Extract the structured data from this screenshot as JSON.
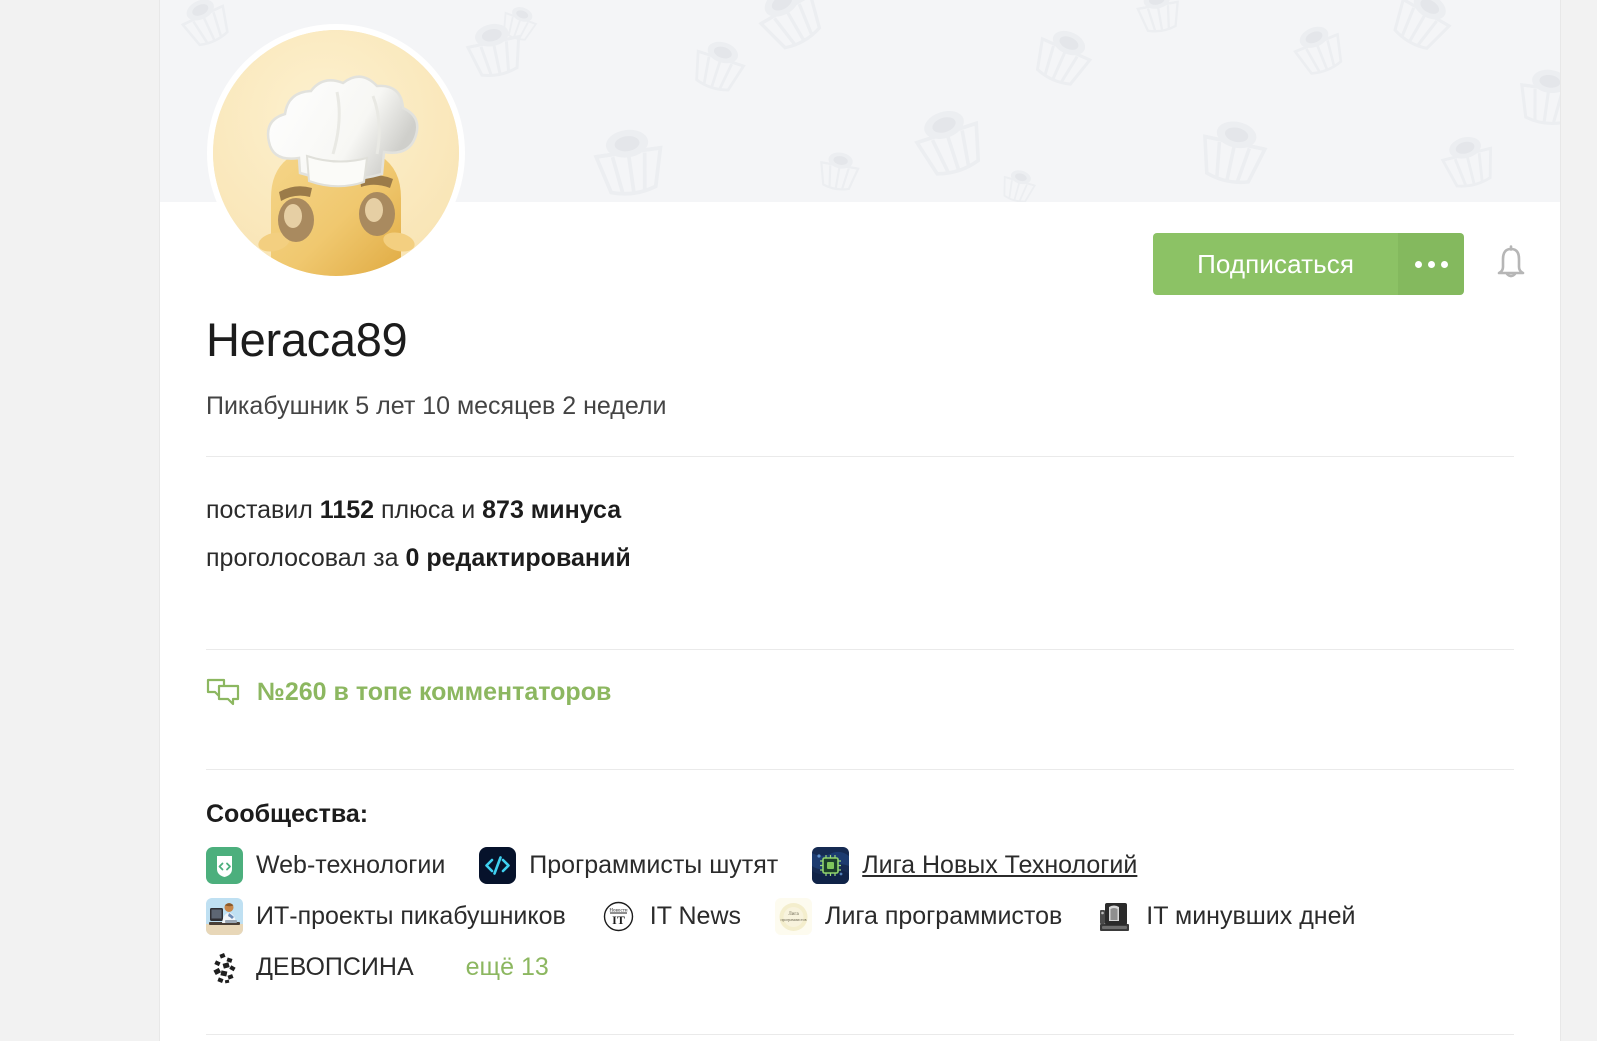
{
  "profile": {
    "username": "Heraca89",
    "subtitle": "Пикабушник 5 лет 10 месяцев 2 недели",
    "avatar_icon": "chef-hat-character-avatar",
    "banner_icon": "cupcake-pattern"
  },
  "actions": {
    "subscribe_label": "Подписаться",
    "more_icon": "ellipsis-icon",
    "bell_icon": "bell-icon",
    "accent_color": "#8cc265",
    "accent_dark_color": "#84b95e"
  },
  "stats": {
    "line1_pre": "поставил ",
    "plus_count": "1152",
    "line1_mid": " плюса и ",
    "minus_count": "873",
    "line1_post": " минуса",
    "line2_pre": "проголосовал за ",
    "edits_count": "0",
    "line2_post": " редактирований"
  },
  "rank": {
    "icon": "comments-icon",
    "text": "№260 в топе комментаторов",
    "color": "#8cb760"
  },
  "communities": {
    "title": "Сообщества:",
    "more_label": "ещё 13",
    "rows": [
      [
        {
          "name": "Web-технологии",
          "icon": "web-shield-code-icon",
          "hovered": false
        },
        {
          "name": "Программисты шутят",
          "icon": "code-tags-dark-icon",
          "hovered": false
        },
        {
          "name": "Лига Новых Технологий",
          "icon": "microchip-circuit-icon",
          "hovered": true
        }
      ],
      [
        {
          "name": "ИТ-проекты пикабушников",
          "icon": "person-at-computer-icon",
          "hovered": false
        },
        {
          "name": "IT News",
          "icon": "it-news-circle-icon",
          "hovered": false
        },
        {
          "name": "Лига программистов",
          "icon": "programmers-league-icon",
          "hovered": false
        },
        {
          "name": "IT минувших дней",
          "icon": "vintage-computer-icon",
          "hovered": false
        }
      ],
      [
        {
          "name": "ДЕВОПСИНА",
          "icon": "scattered-blocks-icon",
          "hovered": false
        }
      ]
    ]
  }
}
